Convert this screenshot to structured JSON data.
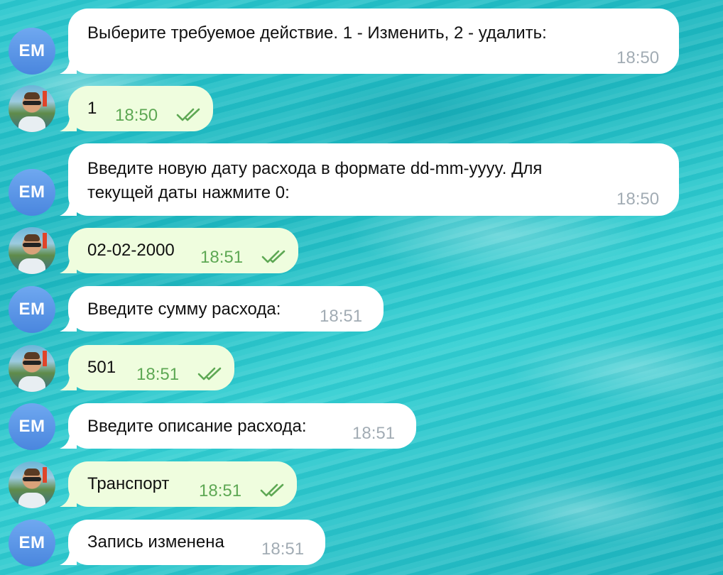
{
  "bot": {
    "initials": "EM"
  },
  "messages": [
    {
      "from": "bot",
      "text": "Выберите требуемое действие. 1 - Изменить, 2 - удалить:",
      "time": "18:50"
    },
    {
      "from": "user",
      "text": "1",
      "time": "18:50",
      "read": true
    },
    {
      "from": "bot",
      "text_line1": "Введите новую дату расхода в формате dd-mm-yyyy. Для",
      "text_line2": "текущей даты нажмите 0:",
      "time": "18:50"
    },
    {
      "from": "user",
      "text": "02-02-2000",
      "time": "18:51",
      "read": true
    },
    {
      "from": "bot",
      "text": "Введите сумму расхода:",
      "time": "18:51"
    },
    {
      "from": "user",
      "text": "501",
      "time": "18:51",
      "read": true
    },
    {
      "from": "bot",
      "text": "Введите описание расхода:",
      "time": "18:51"
    },
    {
      "from": "user",
      "text": "Транспорт",
      "time": "18:51",
      "read": true
    },
    {
      "from": "bot",
      "text": "Запись изменена",
      "time": "18:51"
    }
  ],
  "colors": {
    "incoming_bubble": "#ffffff",
    "outgoing_bubble": "#effdde",
    "incoming_time": "#a2acb4",
    "outgoing_time": "#5ea854",
    "bot_avatar": "#5a93e3"
  }
}
